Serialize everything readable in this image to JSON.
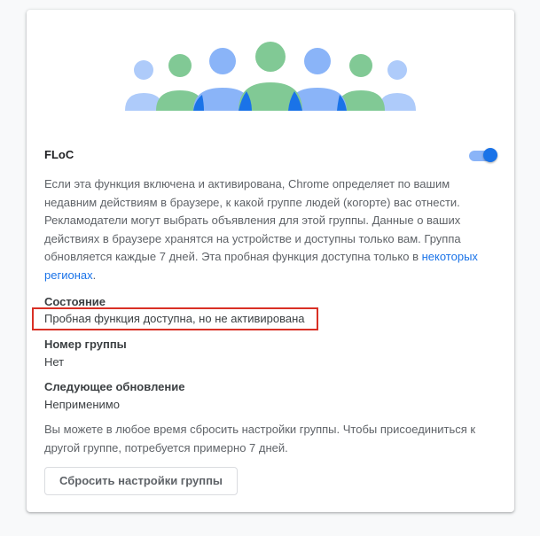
{
  "floc": {
    "title": "FLoC",
    "toggle_on": true,
    "description_before_link": "Если эта функция включена и активирована, Chrome определяет по вашим недавним действиям в браузере, к какой группе людей (когорте) вас отнести. Рекламодатели могут выбрать объявления для этой группы. Данные о ваших действиях в браузере хранятся на устройстве и доступны только вам. Группа обновляется каждые 7 дней. Эта пробная функция доступна только в ",
    "description_link": "некоторых регионах",
    "description_after_link": "."
  },
  "status": {
    "label": "Состояние",
    "value": "Пробная функция доступна, но не активирована"
  },
  "group_number": {
    "label": "Номер группы",
    "value": "Нет"
  },
  "next_update": {
    "label": "Следующее обновление",
    "value": "Неприменимо"
  },
  "reset": {
    "note": "Вы можете в любое время сбросить настройки группы. Чтобы присоединиться к другой группе, потребуется примерно 7 дней.",
    "button_label": "Сбросить настройки группы"
  },
  "colors": {
    "blue": "#8ab4f8",
    "blue_dark": "#1a73e8",
    "green": "#81c995",
    "highlight_border": "#d93025"
  }
}
